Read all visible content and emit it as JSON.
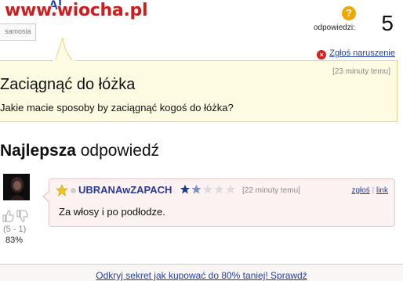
{
  "watermark": {
    "text": "www.wiocha.pl"
  },
  "header": {
    "user_name_partial": "Al...",
    "small_label": "samosia",
    "answers_label": "odpowiedzi:",
    "answers_count": "5",
    "answers_icon": "question-mark-icon"
  },
  "report": {
    "label": "Zgłoś naruszenie"
  },
  "question": {
    "time": "[23 minuty temu]",
    "title": "Zaciągnąć do łóżka",
    "body": "Jakie macie sposoby by zaciągnąć kogoś do łóżka?"
  },
  "best_answer": {
    "heading_bold": "Najlepsza",
    "heading_rest": " odpowiedź",
    "votes": "(5 - 1)",
    "percent": "83%",
    "user": "UBRANAwZAPACH",
    "rank_stars_filled": 1.5,
    "rank_stars_total": 5,
    "time": "[22 minuty temu]",
    "report_link": "zgłoś",
    "separator": "|",
    "permalink": "link",
    "text": "Za włosy i po podłodze."
  },
  "footer": {
    "link": "Odkryj sekret jak kupować do 80% taniej! Sprawdź"
  },
  "colors": {
    "accent_link": "#2240a8",
    "question_bg": "#fdfbe2",
    "answer_bg": "#fdf2f2",
    "watermark": "#d01c1c"
  }
}
